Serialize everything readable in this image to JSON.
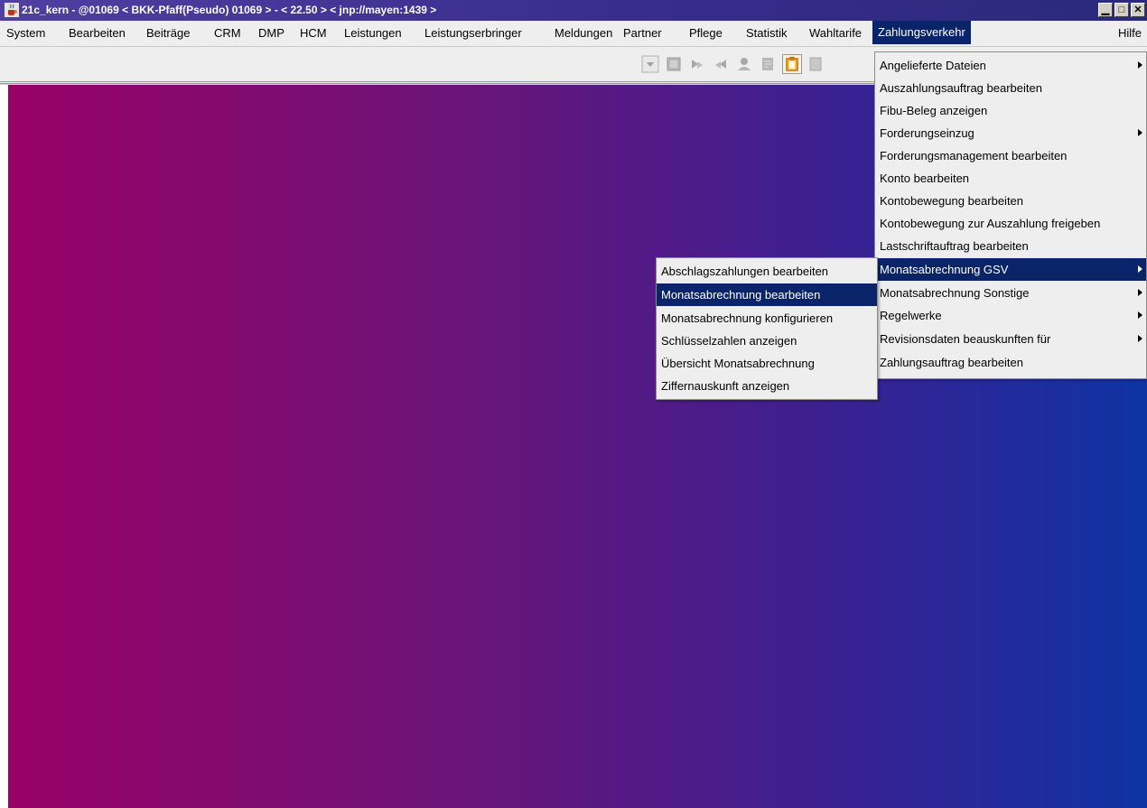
{
  "window": {
    "title": "21c_kern - @01069 < BKK-Pfaff(Pseudo) 01069 > - < 22.50 > < jnp://mayen:1439 >",
    "controls": {
      "minimize": "▁",
      "maximize": "□",
      "close": "✕"
    }
  },
  "menubar": {
    "items": [
      {
        "label": "System"
      },
      {
        "label": "Bearbeiten"
      },
      {
        "label": "Beiträge"
      },
      {
        "label": "CRM"
      },
      {
        "label": "DMP"
      },
      {
        "label": "HCM"
      },
      {
        "label": "Leistungen"
      },
      {
        "label": "Leistungserbringer"
      },
      {
        "label": "Meldungen"
      },
      {
        "label": "Partner"
      },
      {
        "label": "Pflege"
      },
      {
        "label": "Statistik"
      },
      {
        "label": "Wahltarife"
      },
      {
        "label": "Zahlungsverkehr"
      },
      {
        "label": "Hilfe"
      }
    ],
    "active": "Zahlungsverkehr"
  },
  "toolbar": {
    "icons": [
      "dropdown-icon",
      "bookmark-icon",
      "forward-icon",
      "back-icon",
      "person-icon",
      "note-icon",
      "clipboard-icon",
      "document-icon"
    ]
  },
  "zahlungsverkehr_menu": {
    "items": [
      {
        "label": "Angelieferte Dateien",
        "submenu": true
      },
      {
        "label": "Auszahlungsauftrag bearbeiten",
        "submenu": false
      },
      {
        "label": "Fibu-Beleg anzeigen",
        "submenu": false
      },
      {
        "label": "Forderungseinzug",
        "submenu": true
      },
      {
        "label": "Forderungsmanagement bearbeiten",
        "submenu": false
      },
      {
        "label": "Konto bearbeiten",
        "submenu": false
      },
      {
        "label": "Kontobewegung bearbeiten",
        "submenu": false
      },
      {
        "label": "Kontobewegung zur Auszahlung freigeben",
        "submenu": false
      },
      {
        "label": "Lastschriftauftrag bearbeiten",
        "submenu": false
      },
      {
        "label": "Monatsabrechnung GSV",
        "submenu": true,
        "selected": true
      },
      {
        "label": "Monatsabrechnung Sonstige",
        "submenu": true
      },
      {
        "label": "Regelwerke",
        "submenu": true
      },
      {
        "label": "Revisionsdaten beauskunften für",
        "submenu": true
      },
      {
        "label": "Zahlungsauftrag bearbeiten",
        "submenu": false
      }
    ]
  },
  "gsv_submenu": {
    "items": [
      {
        "label": "Abschlagszahlungen bearbeiten"
      },
      {
        "label": "Monatsabrechnung bearbeiten",
        "selected": true
      },
      {
        "label": "Monatsabrechnung konfigurieren"
      },
      {
        "label": "Schlüsselzahlen anzeigen"
      },
      {
        "label": "Übersicht Monatsabrechnung"
      },
      {
        "label": "Ziffernauskunft anzeigen"
      }
    ]
  }
}
